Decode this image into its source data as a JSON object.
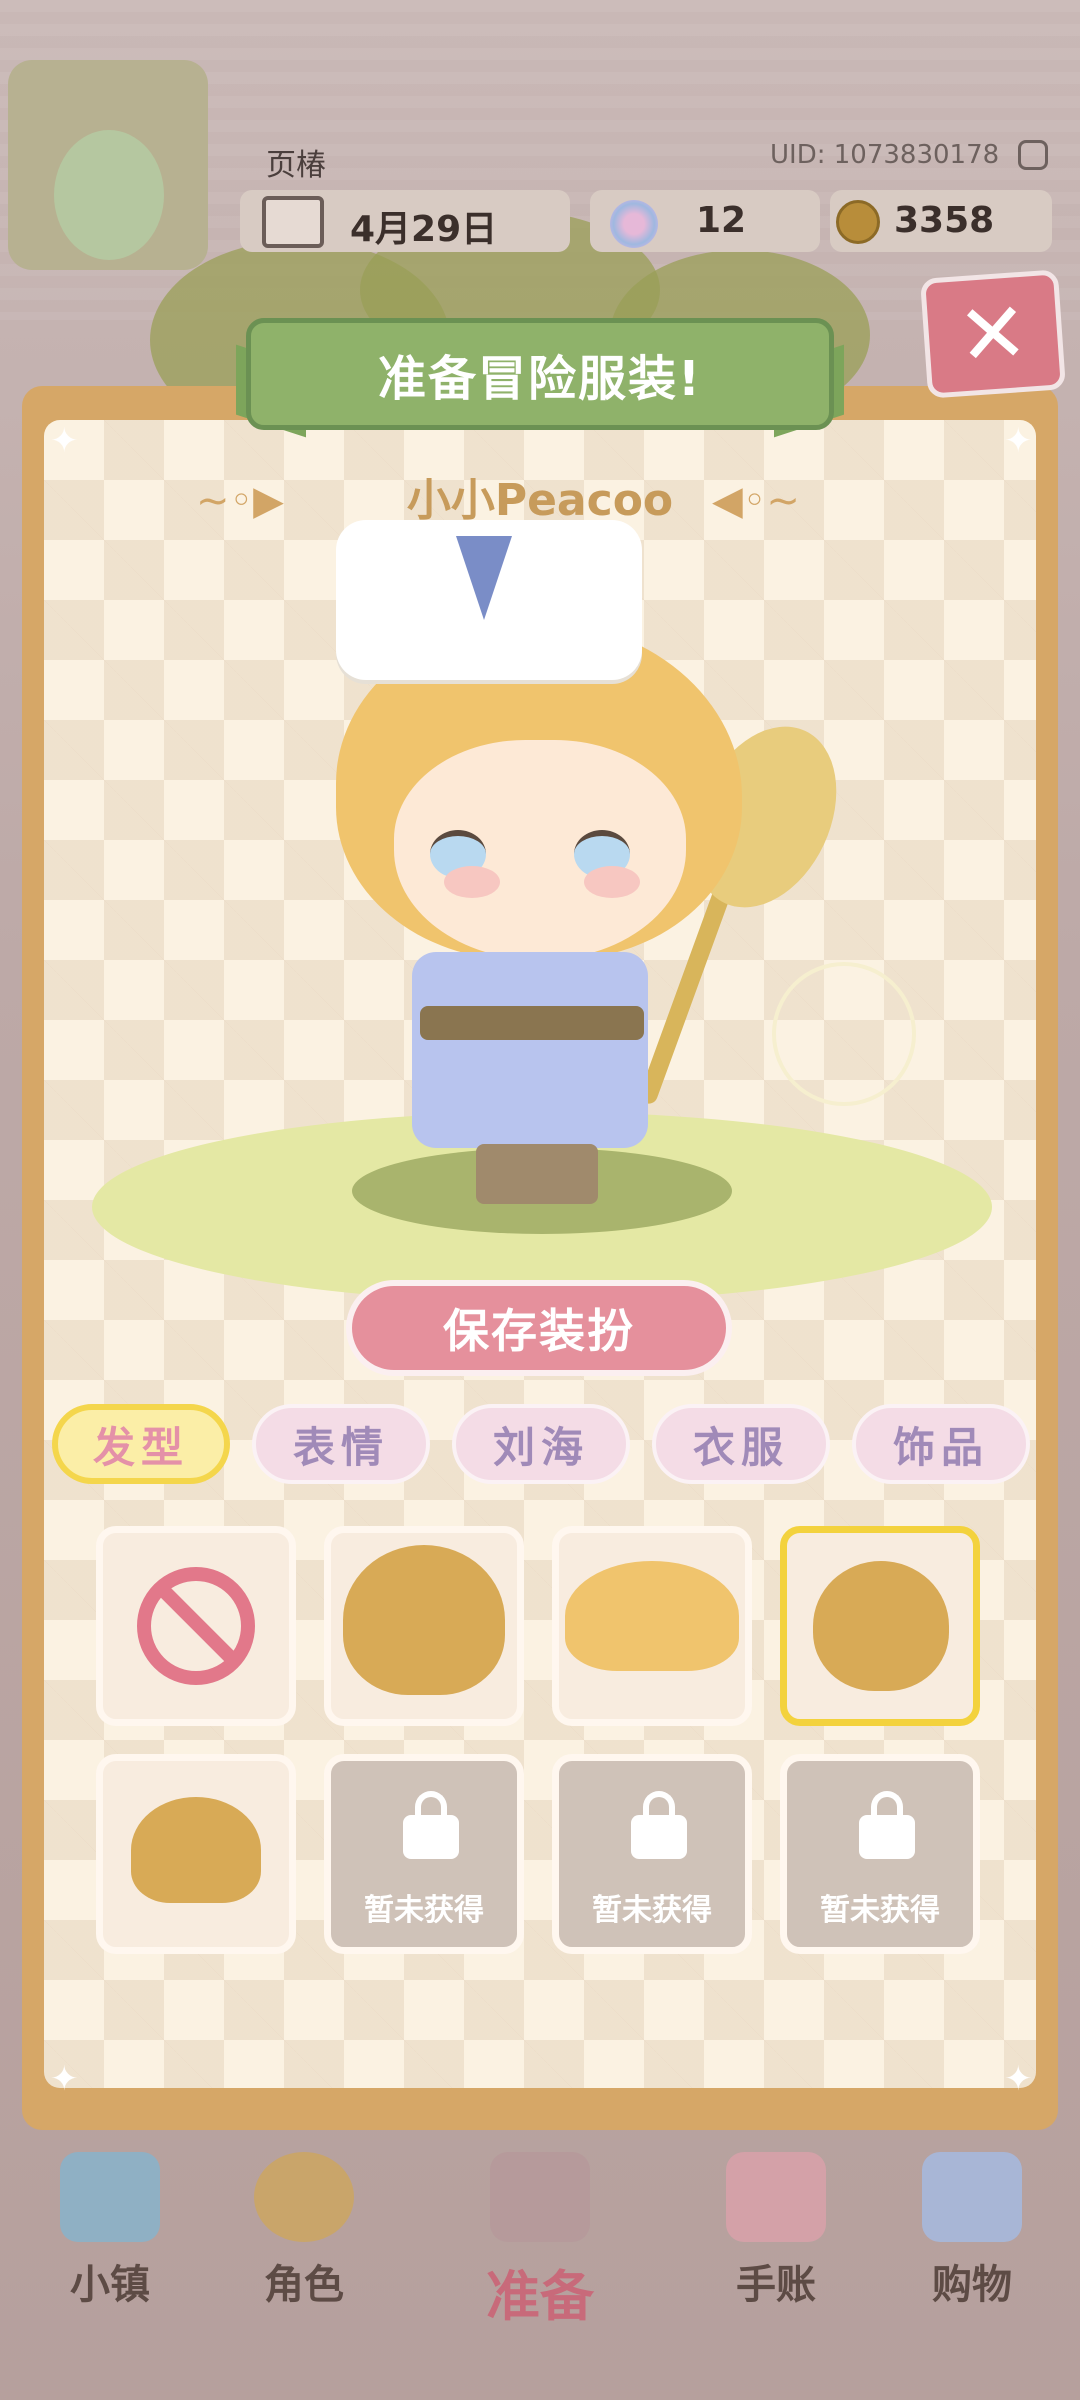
{
  "header": {
    "username": "页椿",
    "uid": "UID: 1073830178",
    "date": "4月29日",
    "flowers": "12",
    "coins": "3358"
  },
  "panel": {
    "title": "准备冒险服装!",
    "character_name": "小小Peacoo",
    "save_button": "保存装扮"
  },
  "tabs": [
    {
      "label": "发型",
      "active": true
    },
    {
      "label": "表情",
      "active": false
    },
    {
      "label": "刘海",
      "active": false
    },
    {
      "label": "衣服",
      "active": false
    },
    {
      "label": "饰品",
      "active": false
    }
  ],
  "slots": {
    "locked_label": "暂未获得"
  },
  "bottom_nav": [
    {
      "label": "小镇"
    },
    {
      "label": "角色"
    },
    {
      "label": "准备"
    },
    {
      "label": "手账"
    },
    {
      "label": "购物"
    }
  ],
  "colors": {
    "accent": "#e5909c",
    "panel_border": "#d6a767",
    "ribbon": "#8fb26a",
    "selected": "#f3d23d"
  }
}
